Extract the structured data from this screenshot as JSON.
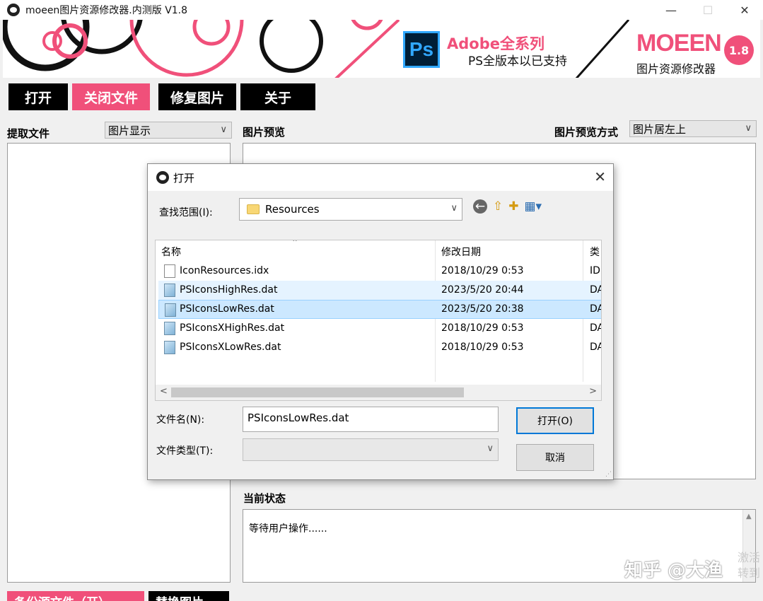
{
  "window": {
    "title": "moeen图片资源修改器.内测版 V1.8",
    "minimize": "—",
    "maximize": "☐",
    "close": "✕"
  },
  "banner": {
    "ps_logo": "Ps",
    "line1": "Adobe全系列",
    "line2": "PS全版本以已支持",
    "brand": "MOEEN",
    "brand_sub": "图片资源修改器",
    "version": "1.8",
    "colors": {
      "pink": "#f0507a",
      "black": "#111111"
    }
  },
  "toolbar": {
    "open": "打开",
    "close_file": "关闭文件",
    "repair": "修复图片",
    "about": "关于"
  },
  "main": {
    "extract_label": "提取文件",
    "display_select": "图片显示",
    "preview_label": "图片预览",
    "preview_mode_label": "图片预览方式",
    "preview_mode_select": "图片居左上",
    "status_label": "当前状态",
    "status_text": "等待用户操作......",
    "bottom_btn1": "备份源文件（开）",
    "bottom_btn2": "替换图片"
  },
  "dialog": {
    "title": "打开",
    "look_in_label": "查找范围(I):",
    "look_in_value": "Resources",
    "columns": {
      "name": "名称",
      "date": "修改日期",
      "type": "类"
    },
    "files": [
      {
        "name": "IconResources.idx",
        "date": "2018/10/29 0:53",
        "type": "ID",
        "kind": "idx",
        "state": "normal"
      },
      {
        "name": "PSIconsHighRes.dat",
        "date": "2023/5/20 20:44",
        "type": "DA",
        "kind": "dat",
        "state": "hover"
      },
      {
        "name": "PSIconsLowRes.dat",
        "date": "2023/5/20 20:38",
        "type": "DA",
        "kind": "dat",
        "state": "selected"
      },
      {
        "name": "PSIconsXHighRes.dat",
        "date": "2018/10/29 0:53",
        "type": "DA",
        "kind": "dat",
        "state": "normal"
      },
      {
        "name": "PSIconsXLowRes.dat",
        "date": "2018/10/29 0:53",
        "type": "DA",
        "kind": "dat",
        "state": "normal"
      }
    ],
    "filename_label": "文件名(N):",
    "filename_value": "PSIconsLowRes.dat",
    "filetype_label": "文件类型(T):",
    "filetype_value": "",
    "open_button": "打开(O)",
    "cancel_button": "取消"
  },
  "watermark": {
    "text": "知乎 @大渔",
    "side": "激活\n转到"
  }
}
